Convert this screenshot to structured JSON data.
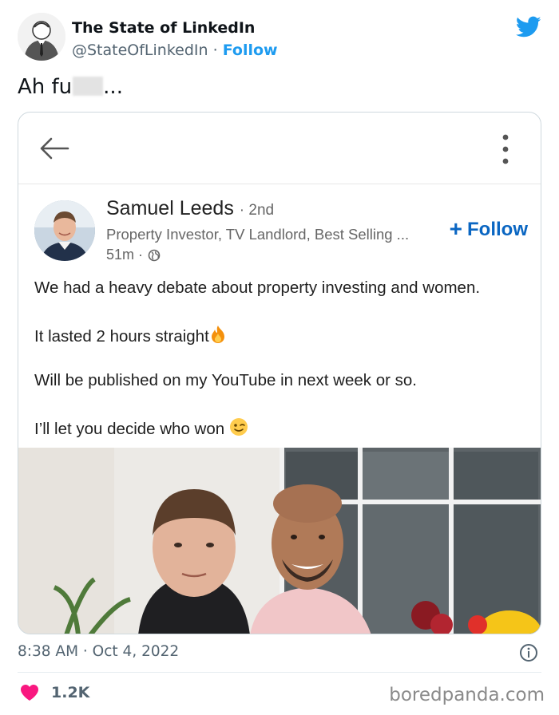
{
  "tweet": {
    "author_name": "The State of LinkedIn",
    "handle": "@StateOfLinkedIn",
    "separator": "·",
    "follow_label": "Follow",
    "text_prefix": "Ah fu",
    "text_suffix": "...",
    "timestamp": "8:38 AM · Oct 4, 2022",
    "like_count": "1.2K"
  },
  "linkedin_post": {
    "author_name": "Samuel Leeds",
    "degree": "· 2nd",
    "headline": "Property Investor, TV Landlord, Best Selling ...",
    "time": "51m ·",
    "follow_label": "Follow",
    "follow_plus": "+",
    "body_lines": [
      "We had a heavy debate about property investing and women.",
      "It lasted 2 hours straight",
      "Will be published on my YouTube in next week or so.",
      "I’ll let you decide who won "
    ]
  },
  "watermark": "boredpanda.com",
  "colors": {
    "twitter_blue": "#1d9bf0",
    "linkedin_blue": "#0a66c2",
    "heart_pink": "#f91880",
    "muted_text": "#536471"
  },
  "icons": [
    "twitter-bird-icon",
    "back-arrow-icon",
    "kebab-menu-icon",
    "globe-icon",
    "fire-emoji-icon",
    "wink-emoji-icon",
    "info-icon",
    "heart-icon"
  ]
}
